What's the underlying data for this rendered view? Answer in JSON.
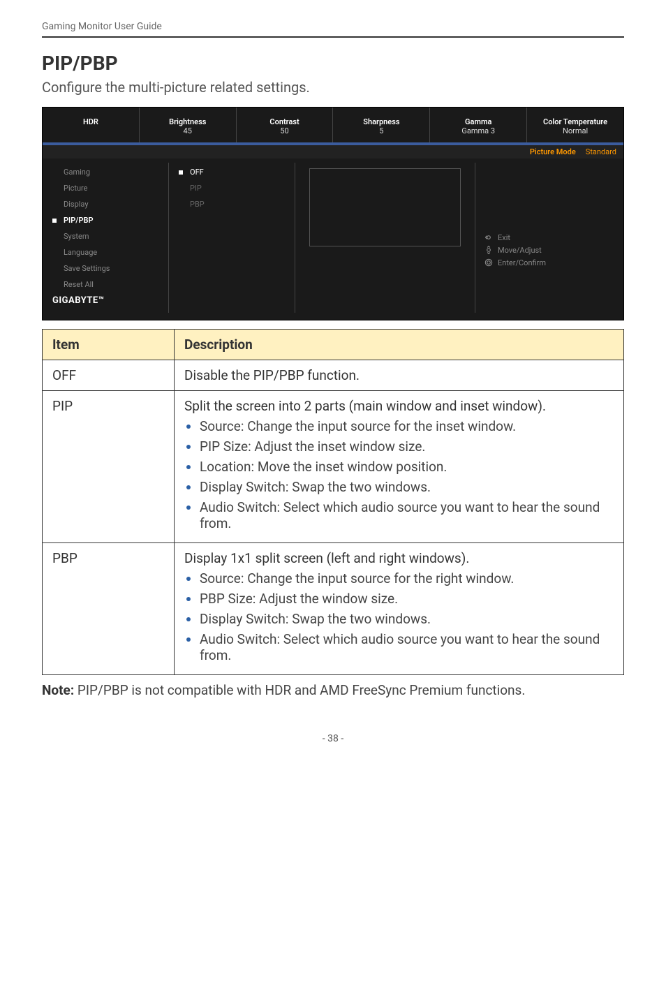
{
  "header": {
    "doc_title": "Gaming Monitor User Guide"
  },
  "section": {
    "title": "PIP/PBP",
    "desc": "Configure the multi-picture related settings."
  },
  "osd": {
    "top": {
      "hdr_label": "HDR",
      "brightness_label": "Brightness",
      "brightness_value": "45",
      "contrast_label": "Contrast",
      "contrast_value": "50",
      "sharpness_label": "Sharpness",
      "sharpness_value": "5",
      "gamma_label": "Gamma",
      "gamma_value": "Gamma 3",
      "colortemp_label": "Color Temperature",
      "colortemp_value": "Normal"
    },
    "status": {
      "picture_mode_label": "Picture Mode",
      "picture_mode_value": "Standard"
    },
    "menu": {
      "items": [
        {
          "label": "Gaming"
        },
        {
          "label": "Picture"
        },
        {
          "label": "Display"
        },
        {
          "label": "PIP/PBP"
        },
        {
          "label": "System"
        },
        {
          "label": "Language"
        },
        {
          "label": "Save Settings"
        },
        {
          "label": "Reset All"
        }
      ]
    },
    "options": {
      "items": [
        {
          "label": "OFF"
        },
        {
          "label": "PIP"
        },
        {
          "label": "PBP"
        }
      ]
    },
    "hints": {
      "exit": "Exit",
      "move": "Move/Adjust",
      "enter": "Enter/Confirm"
    },
    "brand": "GIGABYTE™"
  },
  "table": {
    "col_item": "Item",
    "col_desc": "Description",
    "rows": {
      "off": {
        "item": "OFF",
        "desc": "Disable the PIP/PBP function."
      },
      "pip": {
        "item": "PIP",
        "intro": "Split the screen into 2 parts (main window and inset window).",
        "bullets": [
          "Source:  Change the input source for the inset window.",
          "PIP Size: Adjust the inset window size.",
          "Location:  Move the inset window position.",
          "Display Switch: Swap the two windows.",
          "Audio Switch: Select which audio source you want to hear the sound from."
        ]
      },
      "pbp": {
        "item": "PBP",
        "intro": "Display 1x1 split screen (left and right windows).",
        "bullets": [
          "Source: Change the input source for the right window.",
          "PBP Size: Adjust the window size.",
          "Display Switch: Swap the two windows.",
          "Audio Switch: Select which audio source you want to hear the sound from."
        ]
      }
    }
  },
  "note": {
    "prefix": "Note:",
    "text": " PIP/PBP is not compatible with HDR and AMD FreeSync Premium functions."
  },
  "footer": {
    "page": "- 38 -"
  }
}
